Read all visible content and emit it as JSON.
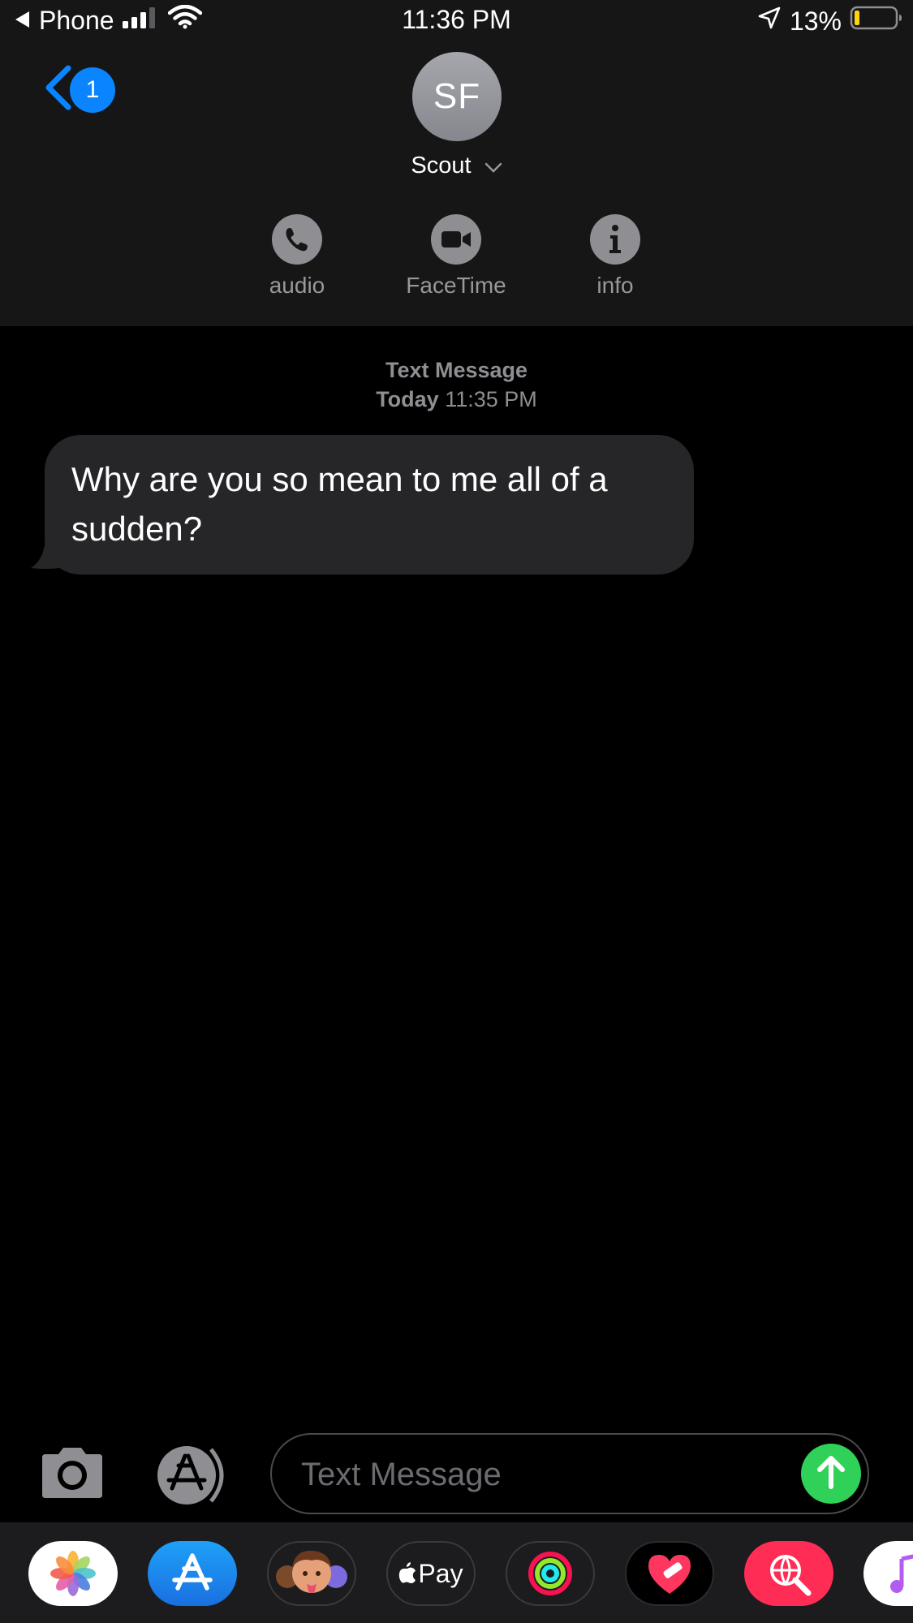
{
  "status_bar": {
    "back_app": "Phone",
    "time": "11:36 PM",
    "battery": "13%"
  },
  "nav": {
    "back_badge": "1",
    "avatar_initials": "SF",
    "contact_name": "Scout"
  },
  "actions": [
    {
      "label": "audio",
      "icon": "phone-icon"
    },
    {
      "label": "FaceTime",
      "icon": "video-icon"
    },
    {
      "label": "info",
      "icon": "info-icon"
    }
  ],
  "thread": {
    "service": "Text Message",
    "day": "Today",
    "time": "11:35 PM",
    "messages": [
      {
        "direction": "incoming",
        "text": "Why are you so mean to me all of a sudden?"
      }
    ]
  },
  "composer": {
    "placeholder": "Text Message"
  },
  "app_drawer": [
    {
      "name": "photos-app-icon",
      "label": ""
    },
    {
      "name": "app-store-app-icon",
      "label": ""
    },
    {
      "name": "memoji-app-icon",
      "label": ""
    },
    {
      "name": "apple-pay-app-icon",
      "label": "Pay"
    },
    {
      "name": "activity-app-icon",
      "label": ""
    },
    {
      "name": "heart-sticker-app-icon",
      "label": ""
    },
    {
      "name": "web-search-app-icon",
      "label": ""
    },
    {
      "name": "music-app-icon",
      "label": ""
    }
  ],
  "colors": {
    "accent_blue": "#0a84ff",
    "send_green": "#30d158",
    "bubble_gray": "#262628",
    "header_bg": "#161617"
  }
}
